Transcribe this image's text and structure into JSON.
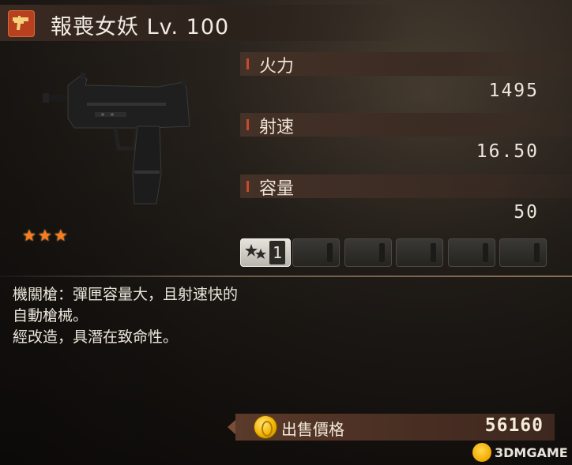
{
  "weapon": {
    "name_level": "報喪女妖 Lv. 100",
    "type_icon": "smg-weapon-icon",
    "image_icon": "uzi-submachine-gun-image",
    "stars": "★★★",
    "star_rating": 3
  },
  "stats": [
    {
      "label": "火力",
      "value": "1495"
    },
    {
      "label": "射速",
      "value": "16.50"
    },
    {
      "label": "容量",
      "value": "50"
    }
  ],
  "upgrades": {
    "active_count": "1",
    "active_icon": "stars-upgrade-icon",
    "total_slots": 6
  },
  "description": {
    "line1": "機關槍：彈匣容量大，且射速快的",
    "line2": "自動槍械。",
    "line3": "經改造，具潛在致命性。"
  },
  "sell": {
    "label": "出售價格",
    "value": "56160",
    "icon": "gold-coin-icon"
  },
  "watermark": {
    "text": "3DMGAME"
  },
  "colors": {
    "accent": "#c64b2a",
    "star": "#ff7a1c",
    "coin": "#f2b400"
  }
}
